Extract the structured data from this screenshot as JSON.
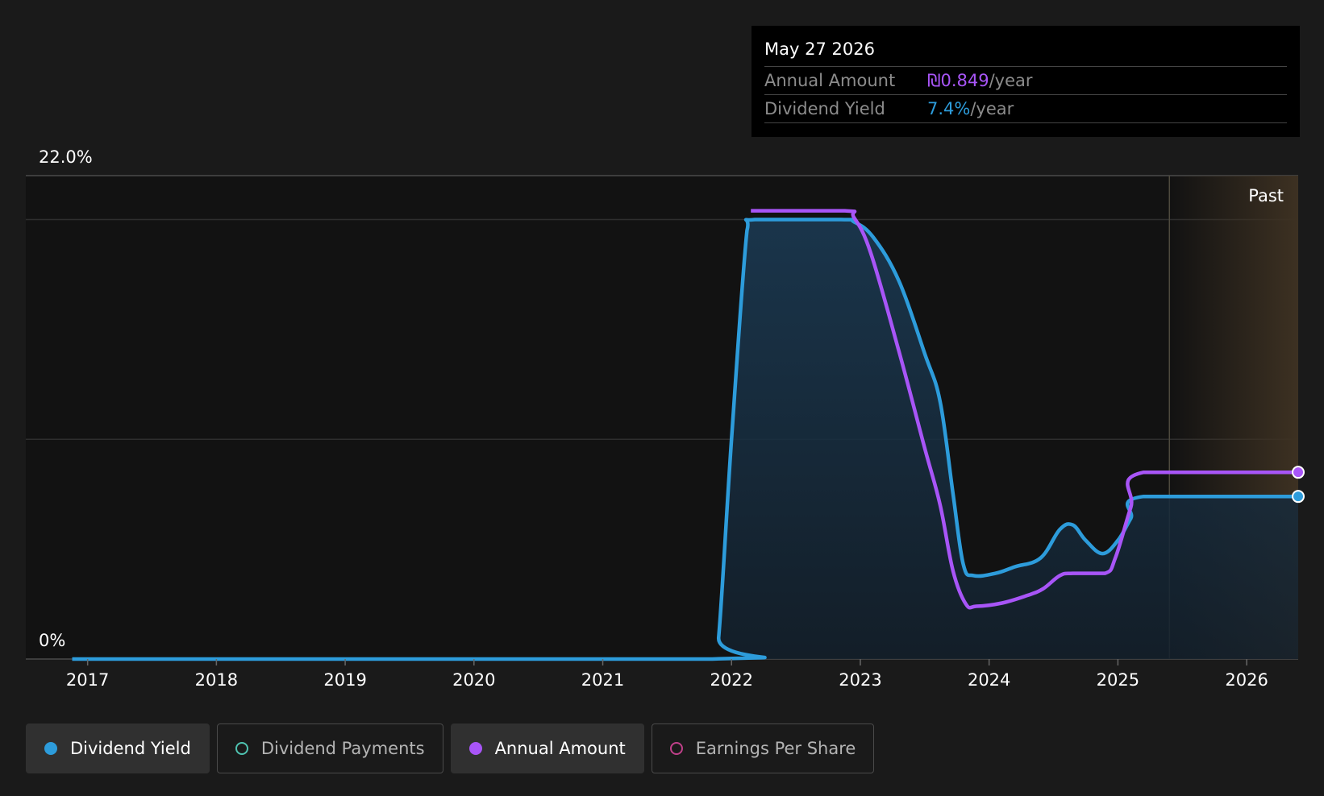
{
  "tooltip": {
    "date": "May 27 2026",
    "annual_amount_label": "Annual Amount",
    "annual_amount_value": "₪0.849",
    "annual_amount_unit": "/year",
    "dividend_yield_label": "Dividend Yield",
    "dividend_yield_value": "7.4%",
    "dividend_yield_unit": "/year"
  },
  "past_label": "Past",
  "legend": [
    {
      "label": "Dividend Yield",
      "color": "#2d9cdb",
      "active": true,
      "filled": true
    },
    {
      "label": "Dividend Payments",
      "color": "#4fc3b1",
      "active": false,
      "filled": false
    },
    {
      "label": "Annual Amount",
      "color": "#a855f7",
      "active": true,
      "filled": true
    },
    {
      "label": "Earnings Per Share",
      "color": "#c0408a",
      "active": false,
      "filled": false
    }
  ],
  "colors": {
    "background": "#1a1a1a",
    "dividend_yield": "#2d9cdb",
    "annual_amount": "#a855f7",
    "past_region": "#3d3122"
  },
  "chart_data": {
    "type": "line",
    "ylim": [
      0,
      22.0
    ],
    "y_tick_labels": [
      "22.0%",
      "0%"
    ],
    "x_tick_labels": [
      "2017",
      "2018",
      "2019",
      "2020",
      "2021",
      "2022",
      "2023",
      "2024",
      "2025",
      "2026"
    ],
    "x_range": [
      2016.52,
      2026.4
    ],
    "past_start": 2025.4,
    "grid": true,
    "series": [
      {
        "name": "Dividend Yield",
        "unit": "%",
        "points": [
          [
            2016.88,
            0
          ],
          [
            2021.85,
            0
          ],
          [
            2021.9,
            1.0
          ],
          [
            2022.0,
            10.0
          ],
          [
            2022.12,
            19.5
          ],
          [
            2022.18,
            20.0
          ],
          [
            2022.85,
            20.0
          ],
          [
            2022.95,
            19.9
          ],
          [
            2023.1,
            19.2
          ],
          [
            2023.3,
            17.2
          ],
          [
            2023.5,
            13.9
          ],
          [
            2023.62,
            11.7
          ],
          [
            2023.72,
            7.5
          ],
          [
            2023.8,
            4.3
          ],
          [
            2023.88,
            3.8
          ],
          [
            2024.05,
            3.9
          ],
          [
            2024.2,
            4.2
          ],
          [
            2024.4,
            4.6
          ],
          [
            2024.55,
            5.9
          ],
          [
            2024.65,
            6.1
          ],
          [
            2024.75,
            5.4
          ],
          [
            2024.88,
            4.8
          ],
          [
            2025.0,
            5.4
          ],
          [
            2025.1,
            6.4
          ],
          [
            2025.2,
            7.4
          ],
          [
            2026.4,
            7.4
          ]
        ]
      },
      {
        "name": "Annual Amount",
        "unit": "₪",
        "points": [
          [
            2022.15,
            20.4
          ],
          [
            2022.88,
            20.4
          ],
          [
            2022.95,
            20.1
          ],
          [
            2023.08,
            18.5
          ],
          [
            2023.3,
            14.0
          ],
          [
            2023.5,
            9.6
          ],
          [
            2023.62,
            7.0
          ],
          [
            2023.72,
            4.0
          ],
          [
            2023.82,
            2.5
          ],
          [
            2023.9,
            2.4
          ],
          [
            2024.1,
            2.55
          ],
          [
            2024.3,
            2.9
          ],
          [
            2024.42,
            3.2
          ],
          [
            2024.55,
            3.8
          ],
          [
            2024.65,
            3.9
          ],
          [
            2024.9,
            3.9
          ],
          [
            2024.98,
            4.6
          ],
          [
            2025.1,
            6.9
          ],
          [
            2025.2,
            8.5
          ],
          [
            2026.4,
            8.5
          ]
        ]
      }
    ]
  }
}
